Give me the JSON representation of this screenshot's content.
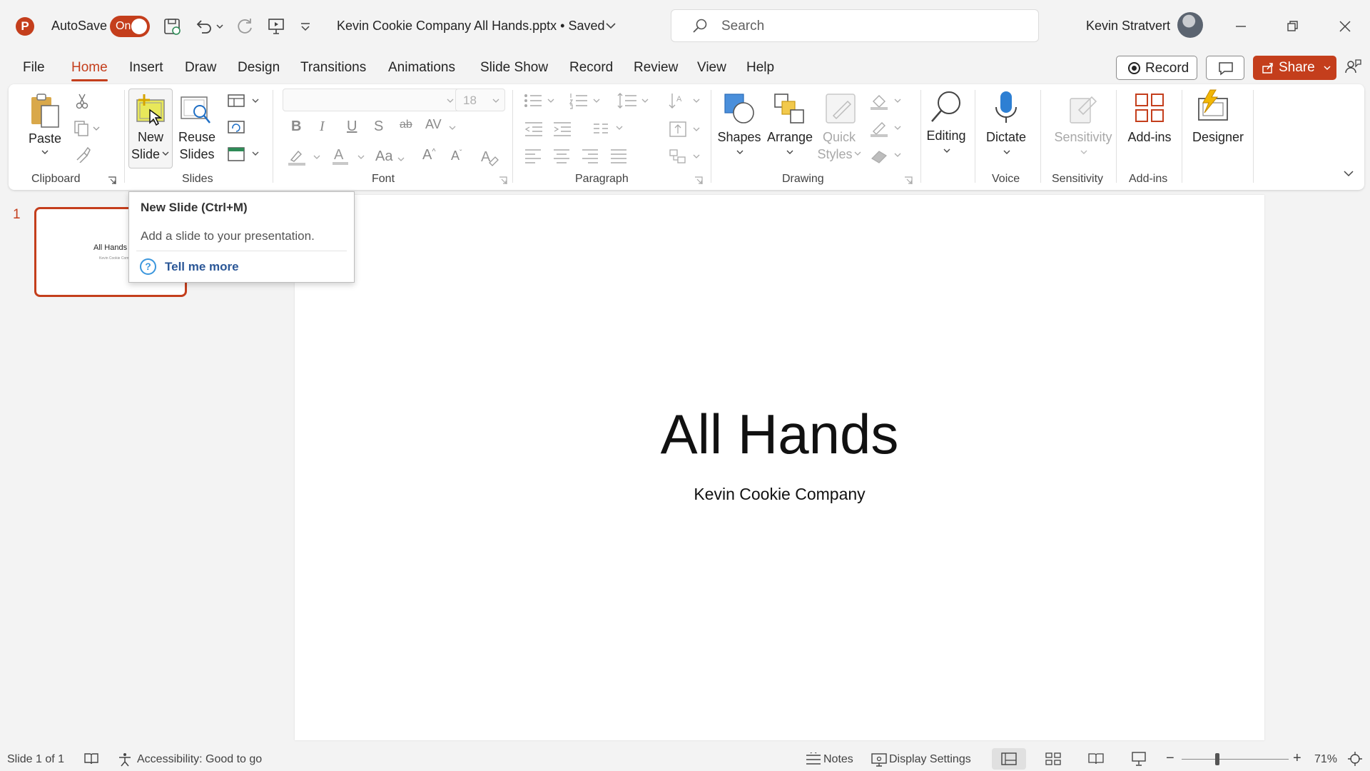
{
  "titlebar": {
    "app_logo": "P",
    "autosave_label": "AutoSave",
    "autosave_state": "On",
    "doc_title": "Kevin Cookie Company All Hands.pptx • Saved",
    "search_placeholder": "Search",
    "user_name": "Kevin Stratvert"
  },
  "menu": {
    "tabs": [
      "File",
      "Home",
      "Insert",
      "Draw",
      "Design",
      "Transitions",
      "Animations",
      "Slide Show",
      "Record",
      "Review",
      "View",
      "Help"
    ],
    "active_tab": "Home",
    "record_label": "Record",
    "share_label": "Share"
  },
  "ribbon": {
    "clipboard": {
      "paste_label": "Paste",
      "group_label": "Clipboard"
    },
    "slides": {
      "new_slide_line1": "New",
      "new_slide_line2": "Slide",
      "reuse_line1": "Reuse",
      "reuse_line2": "Slides",
      "group_label": "Slides"
    },
    "font": {
      "font_size": "18",
      "group_label": "Font"
    },
    "paragraph": {
      "group_label": "Paragraph"
    },
    "drawing": {
      "shapes_label": "Shapes",
      "arrange_label": "Arrange",
      "quick_styles_line1": "Quick",
      "quick_styles_line2": "Styles",
      "group_label": "Drawing"
    },
    "editing": {
      "label": "Editing"
    },
    "voice": {
      "dictate_label": "Dictate",
      "group_label": "Voice"
    },
    "sensitivity": {
      "label": "Sensitivity",
      "group_label": "Sensitivity"
    },
    "addins": {
      "label": "Add-ins",
      "group_label": "Add-ins"
    },
    "designer": {
      "label": "Designer"
    }
  },
  "tooltip": {
    "title": "New Slide (Ctrl+M)",
    "description": "Add a slide to your presentation.",
    "link": "Tell me more"
  },
  "slides_panel": {
    "slide_number": "1",
    "thumb_title": "All Hands",
    "thumb_subtitle": "Kevin Cookie Company"
  },
  "slide": {
    "title": "All Hands",
    "subtitle": "Kevin Cookie Company"
  },
  "statusbar": {
    "slide_info": "Slide 1 of 1",
    "accessibility": "Accessibility: Good to go",
    "notes_label": "Notes",
    "display_settings_label": "Display Settings",
    "zoom_level": "71%",
    "zoom_fraction": 0.71
  },
  "colors": {
    "accent": "#c43e1c",
    "background": "#f3f3f3"
  }
}
